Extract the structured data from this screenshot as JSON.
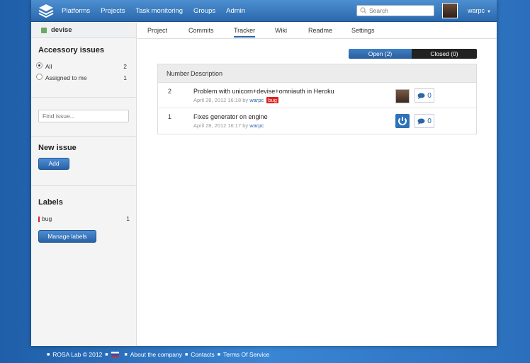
{
  "topnav": {
    "items": [
      "Platforms",
      "Projects",
      "Task monitoring",
      "Groups",
      "Admin"
    ],
    "search_placeholder": "Search",
    "username": "warpc"
  },
  "sidebar": {
    "project_name": "devise",
    "accessory_title": "Accessory issues",
    "filters": [
      {
        "label": "All",
        "count": "2"
      },
      {
        "label": "Assigned to me",
        "count": "1"
      }
    ],
    "find_placeholder": "Find issue...",
    "new_issue_title": "New issue",
    "add_label": "Add",
    "labels_title": "Labels",
    "labels": [
      {
        "name": "bug",
        "count": "1",
        "color": "#dd2222"
      }
    ],
    "manage_labels": "Manage labels"
  },
  "tabs": [
    "Project",
    "Commits",
    "Tracker",
    "Wiki",
    "Readme",
    "Settings"
  ],
  "toggle": {
    "open": "Open (2)",
    "closed": "Closed (0)"
  },
  "table": {
    "headers": [
      "Number",
      "Description"
    ],
    "rows": [
      {
        "number": "2",
        "title": "Problem with unicorn+devise+omniauth in Heroku",
        "date": "April 28, 2012 16:18 by",
        "user": "warpc",
        "label": "bug",
        "comments": "0"
      },
      {
        "number": "1",
        "title": "Fixes generator on engine",
        "date": "April 28, 2012 16:17 by",
        "user": "warpc",
        "label": "",
        "comments": "0"
      }
    ]
  },
  "footer": {
    "copyright": "ROSA Lab © 2012",
    "links": [
      "About the company",
      "Contacts",
      "Terms Of Service"
    ]
  },
  "colors": {
    "accent": "#2a66a8",
    "bug": "#dd2222"
  }
}
